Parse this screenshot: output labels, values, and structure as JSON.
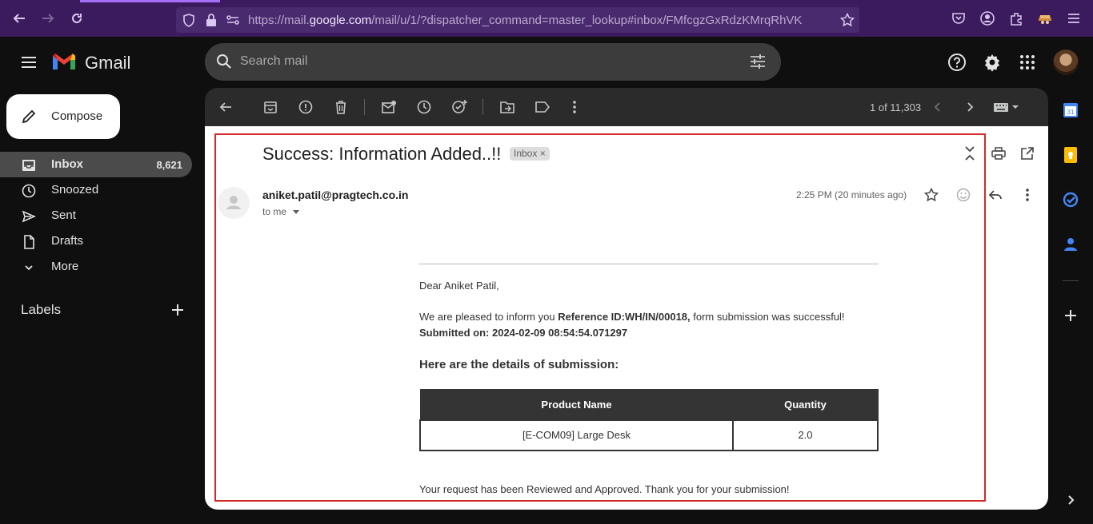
{
  "browser": {
    "url_prefix": "https://mail.",
    "url_domain": "google.com",
    "url_rest": "/mail/u/1/?dispatcher_command=master_lookup#inbox/FMfcgzGxRdzKMrqRhVK"
  },
  "app": {
    "title": "Gmail"
  },
  "search": {
    "placeholder": "Search mail"
  },
  "sidebar": {
    "compose_label": "Compose",
    "items": [
      {
        "label": "Inbox",
        "count": "8,621"
      },
      {
        "label": "Snoozed"
      },
      {
        "label": "Sent"
      },
      {
        "label": "Drafts"
      },
      {
        "label": "More"
      }
    ],
    "labels_header": "Labels"
  },
  "toolbar": {
    "count": "1 of 11,303"
  },
  "email": {
    "subject": "Success: Information Added..!!",
    "label_chip": "Inbox",
    "sender": "aniket.patil@pragtech.co.in",
    "to": "to me",
    "time": "2:25 PM (20 minutes ago)",
    "greeting": "Dear Aniket Patil,",
    "intro": "We are pleased to inform you ",
    "reference": "Reference ID:WH/IN/00018,",
    "intro_end": " form submission was successful!",
    "submitted": "Submitted on: 2024-02-09 08:54:54.071297",
    "details_heading": "Here are the details of submission:",
    "table": {
      "headers": [
        "Product Name",
        "Quantity"
      ],
      "rows": [
        [
          "[E-COM09] Large Desk",
          "2.0"
        ]
      ]
    },
    "closing": "Your request has been Reviewed and Approved. Thank you for your submission!"
  },
  "colors": {
    "browser_bar": "#3b1a5e",
    "background": "#0f0f0f",
    "frame": "#d62828"
  }
}
